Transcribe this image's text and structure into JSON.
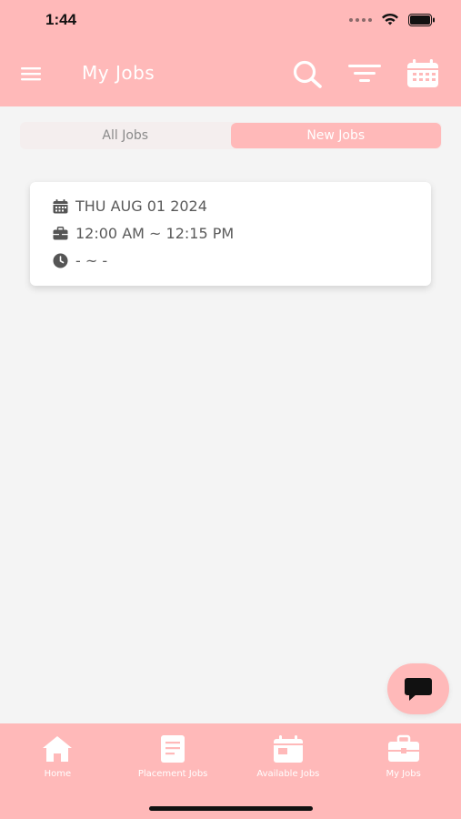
{
  "status_bar": {
    "time": "1:44",
    "icons": [
      "signal-dots-icon",
      "wifi-icon",
      "battery-icon"
    ]
  },
  "app_bar": {
    "title": "My Jobs",
    "icons": [
      "menu-icon",
      "search-icon",
      "filter-icon",
      "calendar-icon"
    ]
  },
  "tabs": [
    {
      "label": "All Jobs",
      "active": false
    },
    {
      "label": "New Jobs",
      "active": true
    }
  ],
  "job_card": {
    "date": "THU AUG 01 2024",
    "time_range": "12:00 AM ~ 12:15 PM",
    "clock_value": "- ~ -",
    "icons": [
      "calendar-icon",
      "briefcase-icon",
      "clock-icon"
    ]
  },
  "chat_button": {
    "icon": "chat-bubble-icon"
  },
  "bottom_nav": [
    {
      "label": "Home",
      "icon": "home-icon"
    },
    {
      "label": "Placement Jobs",
      "icon": "document-icon"
    },
    {
      "label": "Available Jobs",
      "icon": "calendar-card-icon"
    },
    {
      "label": "My Jobs",
      "icon": "briefcase-icon"
    }
  ],
  "colors": {
    "primary": "#ffb9b9",
    "background": "#f4f4f4",
    "card": "#ffffff",
    "text_gray": "#5a5a5a"
  }
}
